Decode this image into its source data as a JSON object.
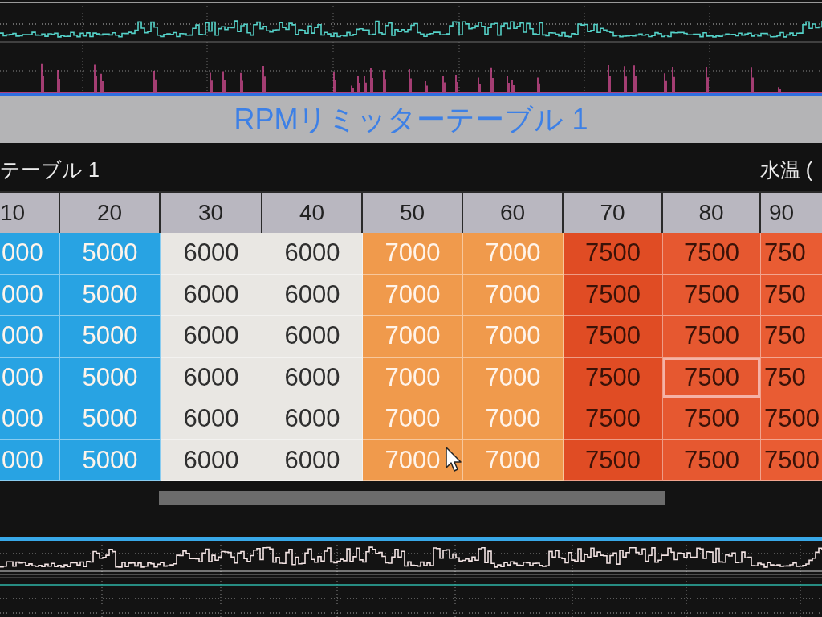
{
  "dialog": {
    "title": "RPMリミッターテーブル 1"
  },
  "table": {
    "name": "テーブル 1",
    "axis_title": "水温 (",
    "columns": [
      {
        "label": "10"
      },
      {
        "label": "20"
      },
      {
        "label": "30"
      },
      {
        "label": "40"
      },
      {
        "label": "50"
      },
      {
        "label": "60"
      },
      {
        "label": "70"
      },
      {
        "label": "80"
      },
      {
        "label": "90"
      }
    ],
    "rows": [
      {
        "cells": [
          {
            "value": "000",
            "color": "#28a3e3",
            "selected": false
          },
          {
            "value": "5000",
            "color": "#28a3e3",
            "selected": false
          },
          {
            "value": "6000",
            "color": "#e9e7e3",
            "selected": false
          },
          {
            "value": "6000",
            "color": "#e9e7e3",
            "selected": false
          },
          {
            "value": "7000",
            "color": "#f09a4c",
            "selected": false
          },
          {
            "value": "7000",
            "color": "#f09a4c",
            "selected": false
          },
          {
            "value": "7500",
            "color": "#e04c24",
            "selected": false
          },
          {
            "value": "7500",
            "color": "#e65830",
            "selected": false
          },
          {
            "value": "750",
            "color": "#e95c33",
            "selected": false
          }
        ]
      },
      {
        "cells": [
          {
            "value": "000",
            "color": "#28a3e3",
            "selected": false
          },
          {
            "value": "5000",
            "color": "#28a3e3",
            "selected": false
          },
          {
            "value": "6000",
            "color": "#e9e7e3",
            "selected": false
          },
          {
            "value": "6000",
            "color": "#e9e7e3",
            "selected": false
          },
          {
            "value": "7000",
            "color": "#f09a4c",
            "selected": false
          },
          {
            "value": "7000",
            "color": "#f09a4c",
            "selected": false
          },
          {
            "value": "7500",
            "color": "#e04c24",
            "selected": false
          },
          {
            "value": "7500",
            "color": "#e65830",
            "selected": false
          },
          {
            "value": "750",
            "color": "#e95c33",
            "selected": false
          }
        ]
      },
      {
        "cells": [
          {
            "value": "000",
            "color": "#28a3e3",
            "selected": false
          },
          {
            "value": "5000",
            "color": "#28a3e3",
            "selected": false
          },
          {
            "value": "6000",
            "color": "#e9e7e3",
            "selected": false
          },
          {
            "value": "6000",
            "color": "#e9e7e3",
            "selected": false
          },
          {
            "value": "7000",
            "color": "#f09a4c",
            "selected": false
          },
          {
            "value": "7000",
            "color": "#f09a4c",
            "selected": false
          },
          {
            "value": "7500",
            "color": "#e04c24",
            "selected": false
          },
          {
            "value": "7500",
            "color": "#e65830",
            "selected": false
          },
          {
            "value": "750",
            "color": "#e95c33",
            "selected": false
          }
        ]
      },
      {
        "cells": [
          {
            "value": "000",
            "color": "#28a3e3",
            "selected": false
          },
          {
            "value": "5000",
            "color": "#28a3e3",
            "selected": false
          },
          {
            "value": "6000",
            "color": "#e9e7e3",
            "selected": false
          },
          {
            "value": "6000",
            "color": "#e9e7e3",
            "selected": false
          },
          {
            "value": "7000",
            "color": "#f09a4c",
            "selected": false
          },
          {
            "value": "7000",
            "color": "#f09a4c",
            "selected": false
          },
          {
            "value": "7500",
            "color": "#e04c24",
            "selected": false
          },
          {
            "value": "7500",
            "color": "#e65830",
            "selected": true
          },
          {
            "value": "750",
            "color": "#e95c33",
            "selected": false
          }
        ]
      },
      {
        "cells": [
          {
            "value": "000",
            "color": "#28a3e3",
            "selected": false
          },
          {
            "value": "5000",
            "color": "#28a3e3",
            "selected": false
          },
          {
            "value": "6000",
            "color": "#e9e7e3",
            "selected": false
          },
          {
            "value": "6000",
            "color": "#e9e7e3",
            "selected": false
          },
          {
            "value": "7000",
            "color": "#f09a4c",
            "selected": false
          },
          {
            "value": "7000",
            "color": "#f09a4c",
            "selected": false
          },
          {
            "value": "7500",
            "color": "#e04c24",
            "selected": false
          },
          {
            "value": "7500",
            "color": "#e65830",
            "selected": false
          },
          {
            "value": "7500",
            "color": "#e95c33",
            "selected": false
          }
        ]
      },
      {
        "cells": [
          {
            "value": "000",
            "color": "#28a3e3",
            "selected": false
          },
          {
            "value": "5000",
            "color": "#28a3e3",
            "selected": false
          },
          {
            "value": "6000",
            "color": "#e9e7e3",
            "selected": false
          },
          {
            "value": "6000",
            "color": "#e9e7e3",
            "selected": false
          },
          {
            "value": "7000",
            "color": "#f09a4c",
            "selected": false
          },
          {
            "value": "7000",
            "color": "#f09a4c",
            "selected": false
          },
          {
            "value": "7500",
            "color": "#e04c24",
            "selected": false
          },
          {
            "value": "7500",
            "color": "#e65830",
            "selected": false
          },
          {
            "value": "7500",
            "color": "#e95c33",
            "selected": false
          }
        ]
      }
    ]
  }
}
